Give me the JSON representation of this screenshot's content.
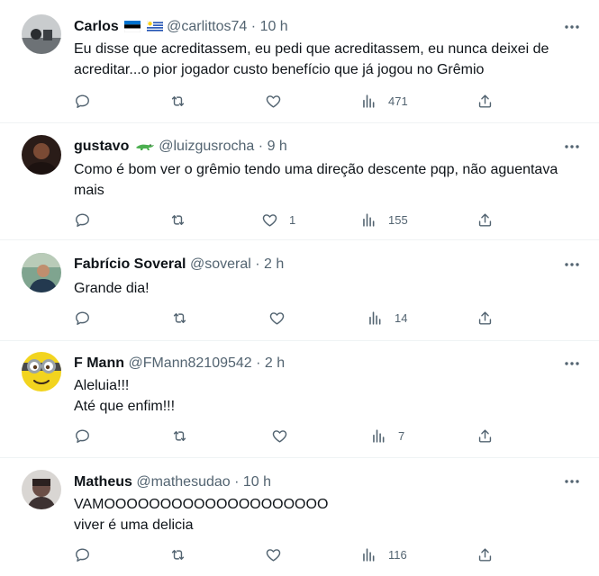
{
  "tweets": [
    {
      "name": "Carlos",
      "flags": [
        "flag-estonia-icon",
        "flag-uruguay-icon"
      ],
      "handle": "@carlittos74",
      "dot": "·",
      "time": "10 h",
      "text": [
        "Eu disse que acreditassem, eu pedi que acreditassem, eu nunca deixei de",
        "acreditar...o pior jogador custo benefício que já jogou no Grêmio"
      ],
      "replies": "",
      "retweets": "",
      "likes": "",
      "views": "471",
      "avatar_color": "#8a8f94"
    },
    {
      "name": "gustavo",
      "emoji": "crocodile-icon",
      "handle": "@luizgusrocha",
      "dot": "·",
      "time": "9 h",
      "text": [
        "Como é bom ver o grêmio tendo uma direção descente pqp, não aguentava",
        "mais"
      ],
      "replies": "",
      "retweets": "",
      "likes": "1",
      "views": "155",
      "avatar_color": "#3b2a24"
    },
    {
      "name": "Fabrício Soveral",
      "handle": "@soveral",
      "dot": "·",
      "time": "2 h",
      "text": [
        "Grande dia!"
      ],
      "replies": "",
      "retweets": "",
      "likes": "",
      "views": "14",
      "avatar_color": "#4a6b5c"
    },
    {
      "name": "F Mann",
      "handle": "@FMann82109542",
      "dot": "·",
      "time": "2 h",
      "text": [
        "Aleluia!!!",
        "Até que enfim!!!"
      ],
      "replies": "",
      "retweets": "",
      "likes": "",
      "views": "7",
      "avatar_color": "#f2d41f"
    },
    {
      "name": "Matheus",
      "handle": "@mathesudao",
      "dot": "·",
      "time": "10 h",
      "text": [
        "VAMOOOOOOOOOOOOOOOOOOOO",
        "viver é uma delicia"
      ],
      "replies": "",
      "retweets": "",
      "likes": "",
      "views": "116",
      "avatar_color": "#5a4a4a"
    }
  ],
  "colors": {
    "text": "#0f1419",
    "muted": "#536471",
    "divider": "#eff3f4"
  }
}
